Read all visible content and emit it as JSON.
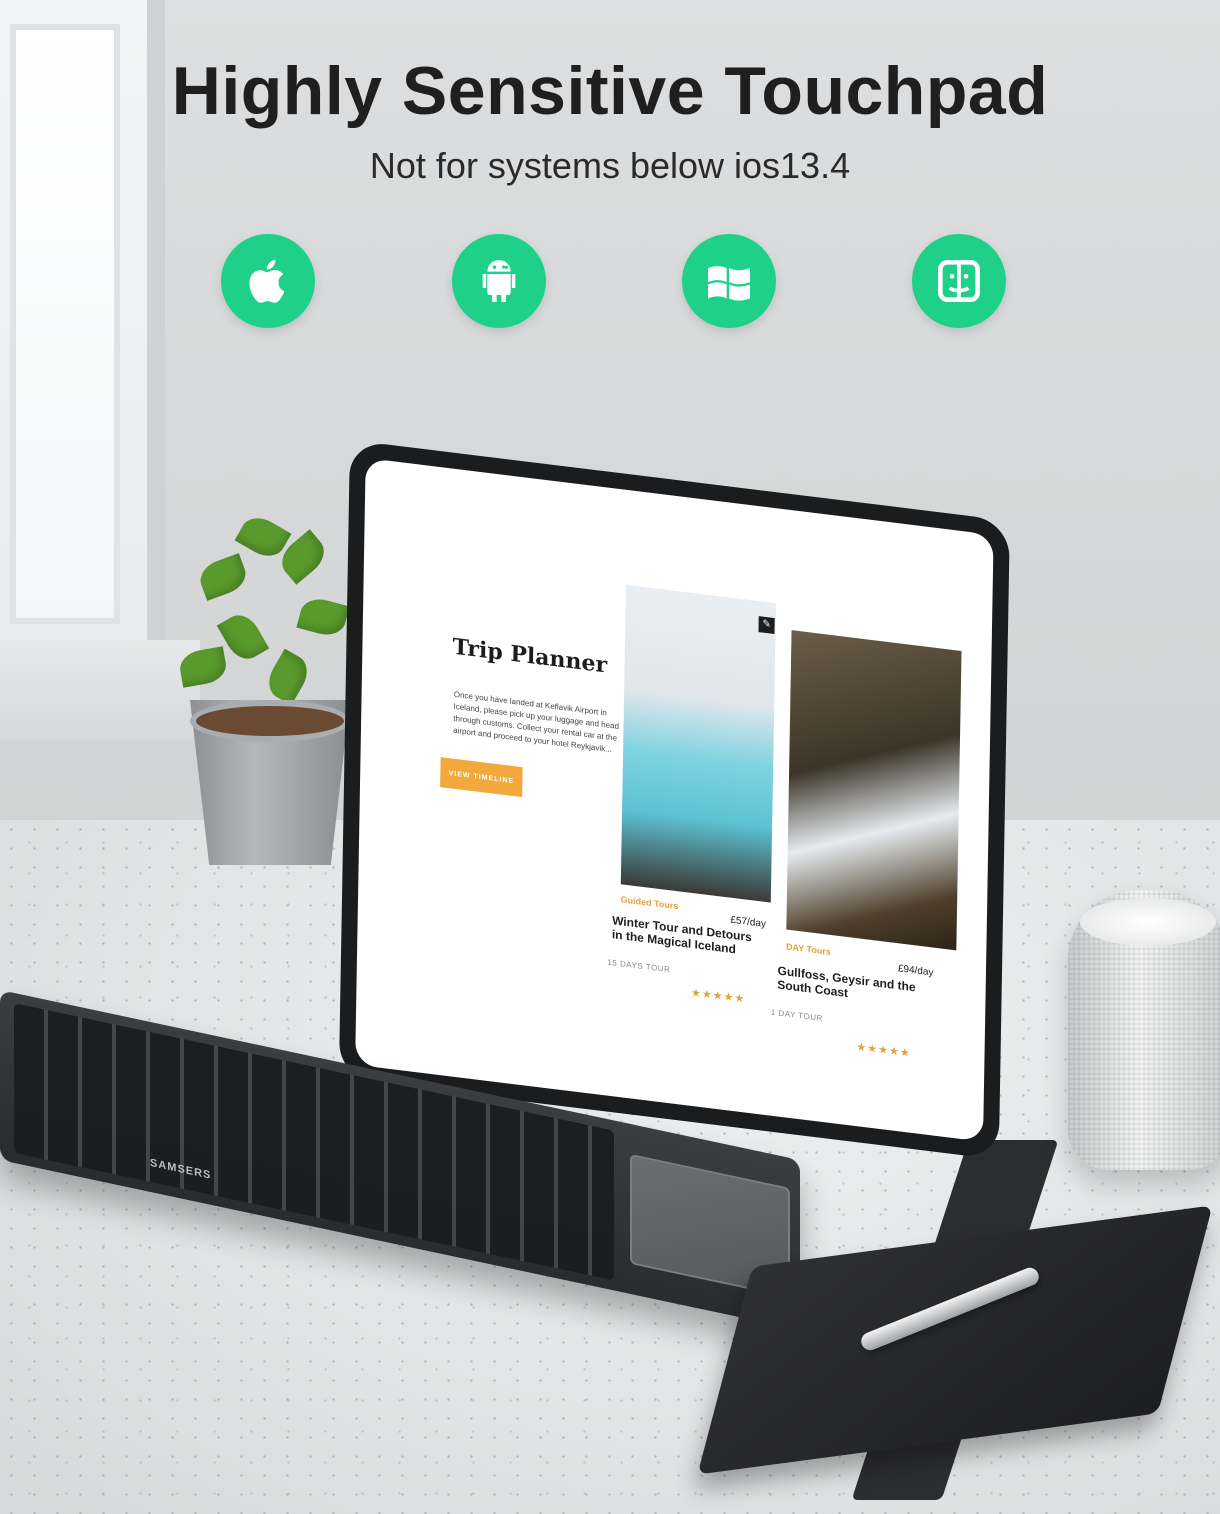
{
  "headline": "Highly Sensitive Touchpad",
  "subline": "Not for systems below ios13.4",
  "colors": {
    "icon_green": "#1fd088",
    "accent_orange": "#f2a83a",
    "text_dark": "#1f1f1f"
  },
  "os_icons": [
    {
      "name": "apple-icon"
    },
    {
      "name": "android-icon"
    },
    {
      "name": "windows-icon"
    },
    {
      "name": "macos-finder-icon"
    }
  ],
  "tablet_screen": {
    "title": "Trip Planner",
    "body": "Once you have landed at Keflavik Airport in Iceland, please pick up your luggage and head through customs. Collect your rental car at the airport and proceed to your hotel Reykjavik...",
    "button": "VIEW TIMELINE",
    "cards": [
      {
        "tag": "Guided Tours",
        "title": "Winter Tour and Detours in the Magical Iceland",
        "price": "£57/day",
        "sub": "15 DAYS TOUR",
        "stars": "★★★★★"
      },
      {
        "tag": "DAY Tours",
        "title": "Gullfoss, Geysir and the South Coast",
        "price": "£94/day",
        "sub": "1 DAY TOUR",
        "stars": "★★★★★"
      }
    ]
  },
  "keyboard": {
    "brand": "SAMSERS"
  }
}
